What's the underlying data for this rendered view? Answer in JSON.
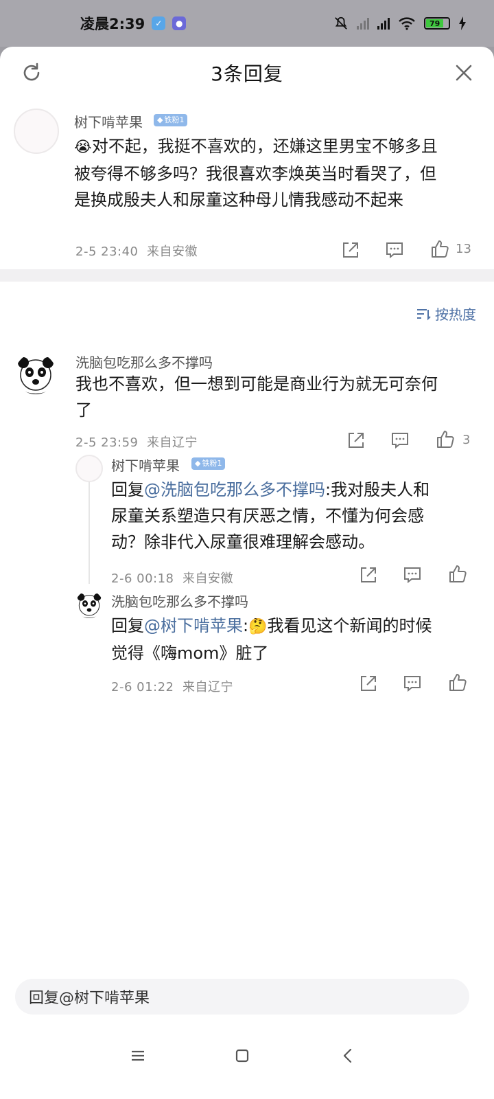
{
  "status_bar": {
    "time": "凌晨2:39",
    "app_icon_1": "shield-check-icon",
    "app_icon_2": "shield-lock-icon",
    "battery_percent": "79",
    "battery_level": 0.79,
    "icons": [
      "mute-icon",
      "signal-icon",
      "signal-icon",
      "wifi-icon",
      "battery-icon",
      "charging-icon"
    ]
  },
  "header": {
    "title": "3条回复",
    "refresh_icon": "refresh-icon",
    "close_icon": "close-icon"
  },
  "root_comment": {
    "username": "树下啃苹果",
    "badge": "铁粉1",
    "emoji": "😭",
    "text_line1": "对不起，我挺不喜欢的，还嫌这里男宝不够多且",
    "text_line2": "被夸得不够多吗？我很喜欢李焕英当时看哭了，但",
    "text_line3": "是换成殷夫人和尿童这种母儿情我感动不起来",
    "time": "2-5 23:40",
    "location": "来自安徽",
    "like_count": "13"
  },
  "sort": {
    "label": "按热度",
    "icon": "sort-icon"
  },
  "comments": [
    {
      "username": "洗脑包吃那么多不撑吗",
      "text_line1": "我也不喜欢，但一想到可能是商业行为就无可奈何",
      "text_line2": "了",
      "time": "2-5 23:59",
      "location": "来自辽宁",
      "like_count": "3"
    }
  ],
  "replies": [
    {
      "username": "树下啃苹果",
      "badge": "铁粉1",
      "prefix": "回复",
      "mention": "@洗脑包吃那么多不撑吗",
      "text_line1_rest": ":我对殷夫人和",
      "text_line2": "尿童关系塑造只有厌恶之情，不懂为何会感",
      "text_line3": "动？除非代入尿童很难理解会感动。",
      "time": "2-6 00:18",
      "location": "来自安徽"
    },
    {
      "username": "洗脑包吃那么多不撑吗",
      "prefix": "回复",
      "mention": "@树下啃苹果",
      "emoji": "🤔",
      "text_line1_rest": "我看见这个新闻的时候",
      "text_line2": "觉得《嗨mom》脏了",
      "time": "2-6 01:22",
      "location": "来自辽宁"
    }
  ],
  "reply_input": {
    "placeholder": "回复@树下啃苹果"
  },
  "nav": {
    "menu_icon": "menu-icon",
    "home_icon": "home-icon",
    "back_icon": "back-icon"
  }
}
